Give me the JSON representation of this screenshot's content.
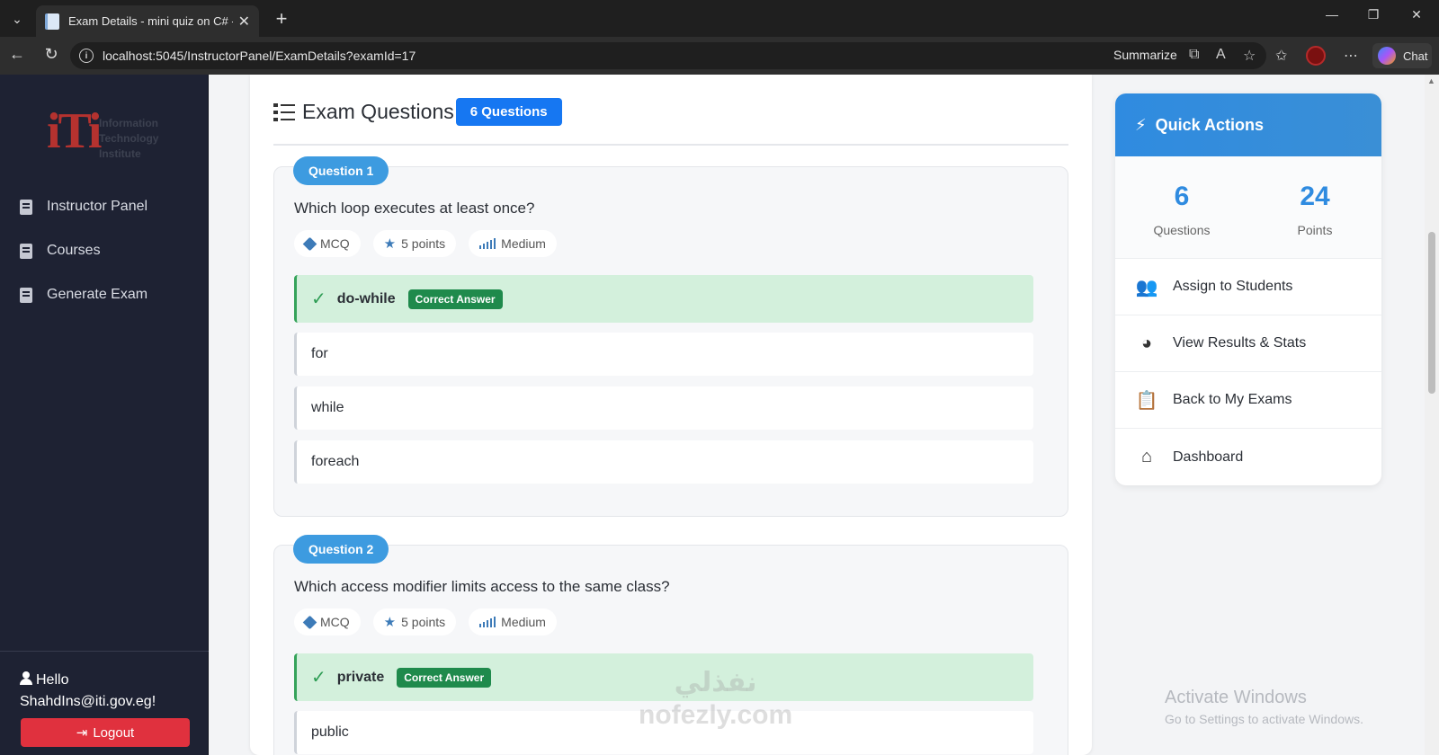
{
  "browser": {
    "tab_title": "Exam Details - mini quiz on C# - IT",
    "url": "localhost:5045/InstructorPanel/ExamDetails?examId=17",
    "summarize_label": "Summarize",
    "chat_label": "Chat"
  },
  "sidebar": {
    "logo_text_1": "Information",
    "logo_text_2": "Technology",
    "logo_text_3": "Institute",
    "items": [
      {
        "label": "Instructor Panel"
      },
      {
        "label": "Courses"
      },
      {
        "label": "Generate Exam"
      }
    ],
    "hello": "Hello",
    "email": "ShahdIns@iti.gov.eg!",
    "logout_label": "Logout"
  },
  "main": {
    "title": "Exam Questions",
    "count_badge": "6 Questions",
    "questions": [
      {
        "label": "Question 1",
        "text": "Which loop executes at least once?",
        "type": "MCQ",
        "points": "5 points",
        "difficulty": "Medium",
        "options": [
          "do-while",
          "for",
          "while",
          "foreach"
        ],
        "correct_label": "Correct Answer"
      },
      {
        "label": "Question 2",
        "text": "Which access modifier limits access to the same class?",
        "type": "MCQ",
        "points": "5 points",
        "difficulty": "Medium",
        "options": [
          "private",
          "public"
        ],
        "correct_label": "Correct Answer"
      }
    ]
  },
  "quick_actions": {
    "title": "Quick Actions",
    "stats": [
      {
        "value": "6",
        "label": "Questions"
      },
      {
        "value": "24",
        "label": "Points"
      }
    ],
    "items": [
      {
        "label": "Assign to Students",
        "icon": "users-icon"
      },
      {
        "label": "View Results & Stats",
        "icon": "pie-chart-icon"
      },
      {
        "label": "Back to My Exams",
        "icon": "clipboard-icon"
      },
      {
        "label": "Dashboard",
        "icon": "home-icon"
      }
    ]
  },
  "watermark": {
    "line1": "Activate Windows",
    "line2": "Go to Settings to activate Windows.",
    "nofezly_ar": "نفذلي",
    "nofezly": "nofezly.com"
  },
  "colors": {
    "accent": "#1677f2",
    "sidebar_bg": "#1e2233",
    "correct_bg": "#d3f0dc",
    "logout": "#e0313e"
  }
}
